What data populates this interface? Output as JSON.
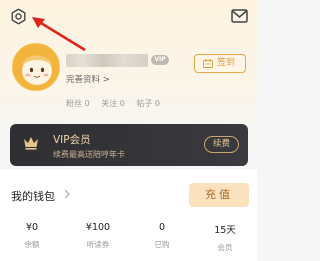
{
  "header": {
    "settings_icon": "gear-icon",
    "mail_icon": "mail-icon",
    "accent": "#e7a64a"
  },
  "profile": {
    "vip_badge": "VIP",
    "complete_profile": "完善资料 >",
    "checkin_label": "签到",
    "stats": [
      {
        "label": "粉丝",
        "value": "0"
      },
      {
        "label": "关注",
        "value": "0"
      },
      {
        "label": "帖子",
        "value": "0"
      }
    ]
  },
  "vip_card": {
    "title": "VIP会员",
    "subtitle": "续费最高送陪哼年卡",
    "renew_label": "续费"
  },
  "wallet": {
    "title": "我的钱包",
    "recharge_label": "充值",
    "items": [
      {
        "value": "¥0",
        "label": "余额"
      },
      {
        "value": "¥100",
        "label": "听读券"
      },
      {
        "value": "0",
        "label": "已购"
      },
      {
        "value": "15天",
        "label": "会员"
      }
    ]
  }
}
